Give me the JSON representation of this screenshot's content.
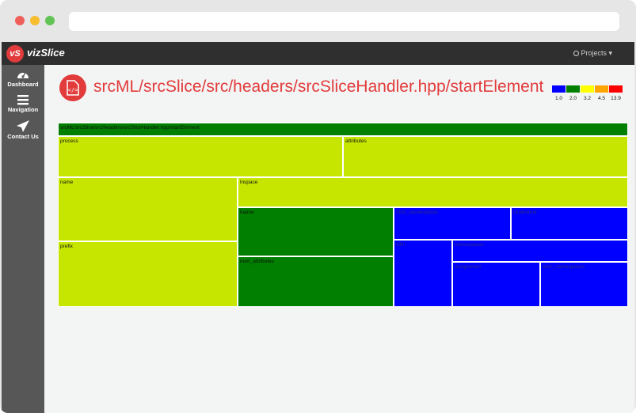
{
  "app": {
    "brand": "vizSlice",
    "logo_text": "vS",
    "projects_label": "Projects",
    "projects_icon": "github-icon"
  },
  "sidebar": {
    "items": [
      {
        "label": "Dashboard",
        "icon": "dashboard-icon"
      },
      {
        "label": "Navigation",
        "icon": "menu-icon"
      },
      {
        "label": "Contact Us",
        "icon": "send-icon"
      }
    ]
  },
  "page": {
    "title": "srcML/srcSlice/src/headers/srcSliceHandler.hpp/startElement",
    "title_color": "#e23b3b",
    "icon": "code-file-icon"
  },
  "legend": {
    "items": [
      {
        "color": "#0000ff",
        "label": "1.0"
      },
      {
        "color": "#007f00",
        "label": "2.0"
      },
      {
        "color": "#ffff00",
        "label": "3.2"
      },
      {
        "color": "#ffa500",
        "label": "4.5"
      },
      {
        "color": "#ff0000",
        "label": "13.9"
      }
    ]
  },
  "treemap": {
    "root": "srcML/srcSlice/src/headers/srcSliceHandler.hpp/startElement",
    "cells": {
      "process": "process",
      "attributes": "attributes",
      "name": "name",
      "lnspace": "lnspace",
      "prefix": "prefix",
      "lname": "lname",
      "num_namespaces": "num_namespaces",
      "localname": "localname",
      "num_attributes": "num_attributes",
      "uri": "URI",
      "namespaces": "namespaces",
      "assignment": "assignment",
      "num_namespaces2": "num_namespaces"
    }
  }
}
